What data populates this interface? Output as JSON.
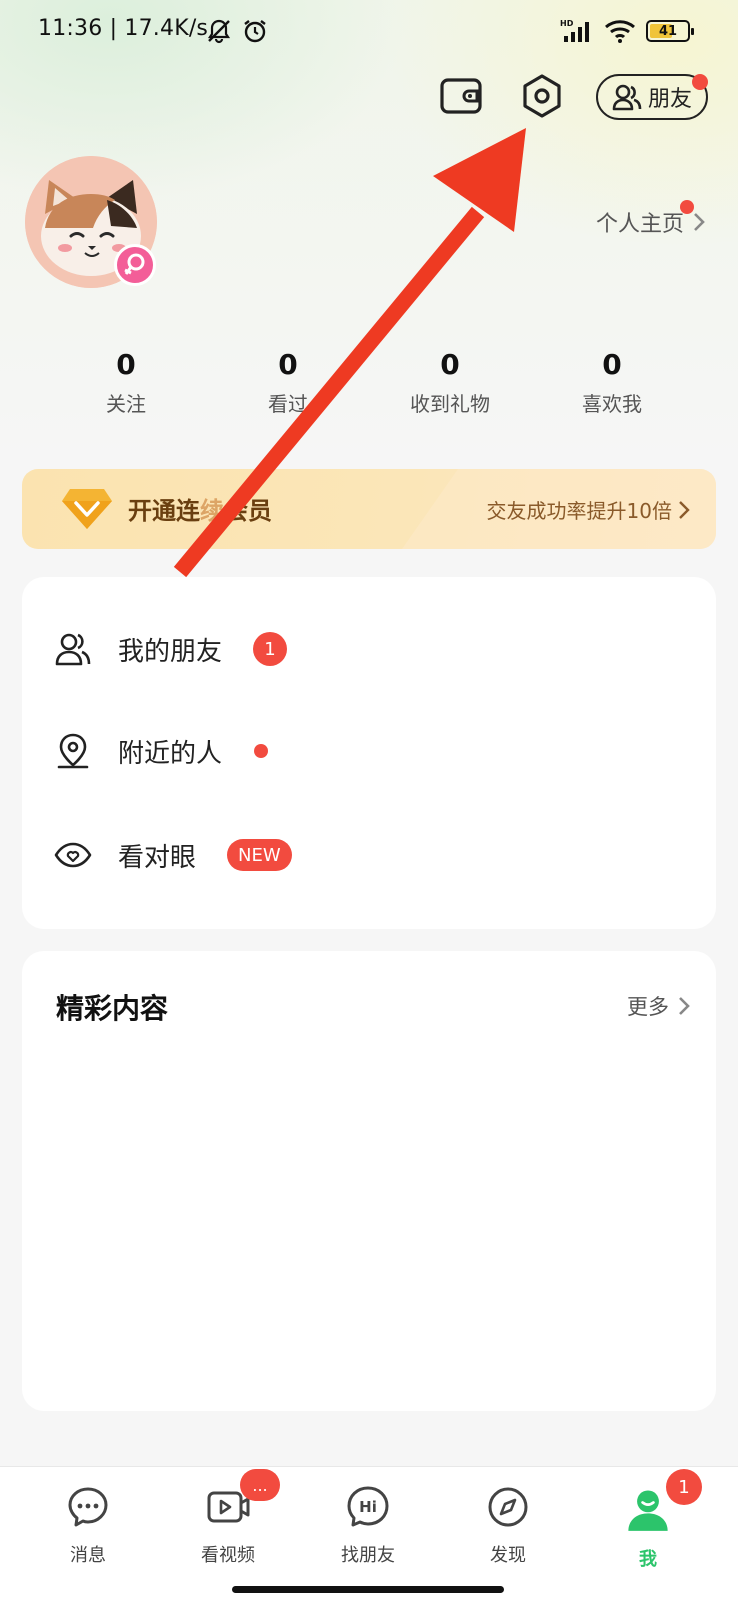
{
  "status_bar": {
    "time": "11:36",
    "speed": "17.4K/s",
    "battery": "41",
    "icons": [
      "mute-icon",
      "alarm-icon",
      "signal-icon",
      "wifi-icon",
      "battery-icon"
    ]
  },
  "header": {
    "friends_label": "朋友"
  },
  "profile": {
    "home_link": "个人主页"
  },
  "stats": [
    {
      "value": "0",
      "label": "关注"
    },
    {
      "value": "0",
      "label": "看过"
    },
    {
      "value": "0",
      "label": "收到礼物"
    },
    {
      "value": "0",
      "label": "喜欢我"
    }
  ],
  "vip": {
    "title": "开通连",
    "title_tail": "会员",
    "subtitle": "交友成功率提升10倍"
  },
  "menu": [
    {
      "label": "我的朋友",
      "badge": "1"
    },
    {
      "label": "附近的人"
    },
    {
      "label": "看对眼",
      "badge": "NEW"
    }
  ],
  "content": {
    "title": "精彩内容",
    "more": "更多"
  },
  "tabs": [
    {
      "label": "消息",
      "icon": "message-icon"
    },
    {
      "label": "看视频",
      "icon": "video-icon",
      "badge": "..."
    },
    {
      "label": "找朋友",
      "icon": "hi-icon"
    },
    {
      "label": "发现",
      "icon": "compass-icon"
    },
    {
      "label": "我",
      "icon": "profile-icon",
      "badge": "1"
    }
  ],
  "colors": {
    "accent_red": "#f24b3f",
    "brand_green": "#2cc46b",
    "vip_gold": "#f4b433",
    "annotation_arrow": "#ee3a22"
  }
}
